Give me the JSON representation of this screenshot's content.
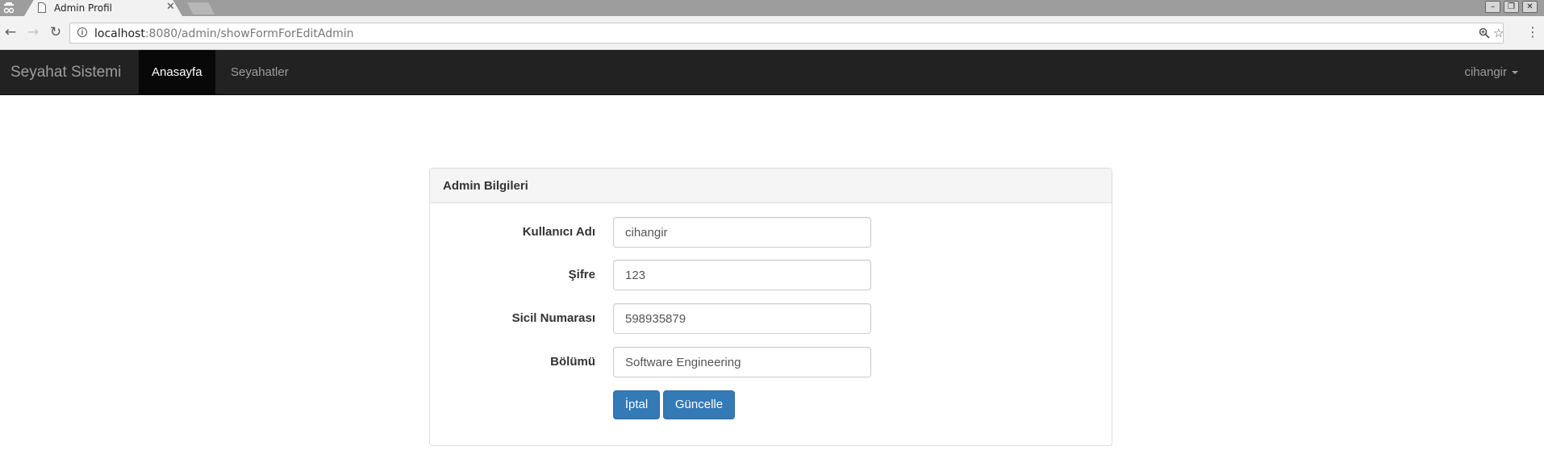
{
  "browser": {
    "tab_title": "Admin Profil",
    "tab_close_glyph": "✕",
    "url_host": "localhost",
    "url_rest": ":8080/admin/showFormForEditAdmin",
    "icons": {
      "back": "back-icon",
      "forward": "forward-icon",
      "reload": "reload-icon",
      "info": "info-icon",
      "zoom": "zoom-icon",
      "bookmark": "star-icon",
      "menu": "menu-dots-icon"
    },
    "window_controls": {
      "minimize": "–",
      "restore": "❐",
      "close": "✕"
    }
  },
  "navbar": {
    "brand": "Seyahat Sistemi",
    "items": [
      {
        "label": "Anasayfa",
        "active": true
      },
      {
        "label": "Seyahatler",
        "active": false
      }
    ],
    "user": "cihangir",
    "colors": {
      "background": "#222222",
      "active_bg": "#080808",
      "text": "#9d9d9d"
    }
  },
  "panel": {
    "heading": "Admin Bilgileri",
    "fields": [
      {
        "label": "Kullanıcı Adı",
        "value": "cihangir"
      },
      {
        "label": "Şifre",
        "value": "123"
      },
      {
        "label": "Sicil Numarası",
        "value": "598935879"
      },
      {
        "label": "Bölümü",
        "value": "Software Engineering"
      }
    ],
    "buttons": {
      "cancel": "İptal",
      "update": "Güncelle"
    },
    "colors": {
      "primary": "#337ab7"
    }
  }
}
